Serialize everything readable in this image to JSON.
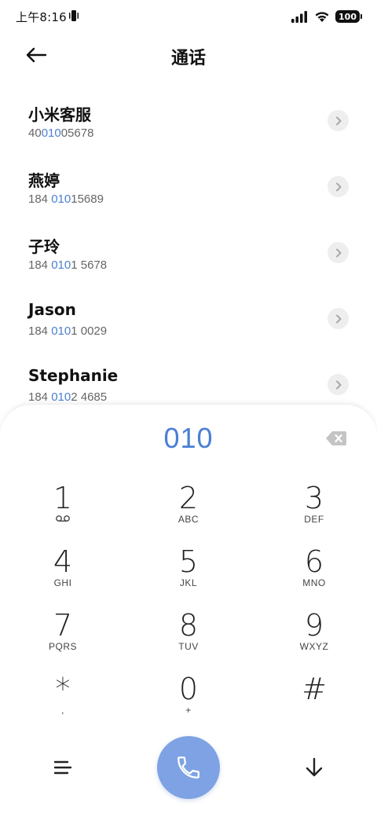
{
  "status_bar": {
    "time": "上午8:16",
    "battery": "100"
  },
  "header": {
    "title": "通话"
  },
  "contacts": [
    {
      "name": "小米客服",
      "number_pre": "40",
      "number_match": "010",
      "number_post": "05678"
    },
    {
      "name": "燕婷",
      "number_pre": "184 ",
      "number_match": "010",
      "number_post": "15689"
    },
    {
      "name": "子玲",
      "number_pre": "184 ",
      "number_match": "010",
      "number_post": "1 5678"
    },
    {
      "name": "Jason",
      "number_pre": "184 ",
      "number_match": "010",
      "number_post": "1 0029"
    },
    {
      "name": "Stephanie",
      "number_pre": "184 ",
      "number_match": "010",
      "number_post": "2 4685"
    }
  ],
  "dialpad": {
    "input": "010",
    "keys": [
      {
        "digit": "1",
        "sub": ""
      },
      {
        "digit": "2",
        "sub": "ABC"
      },
      {
        "digit": "3",
        "sub": "DEF"
      },
      {
        "digit": "4",
        "sub": "GHI"
      },
      {
        "digit": "5",
        "sub": "JKL"
      },
      {
        "digit": "6",
        "sub": "MNO"
      },
      {
        "digit": "7",
        "sub": "PQRS"
      },
      {
        "digit": "8",
        "sub": "TUV"
      },
      {
        "digit": "9",
        "sub": "WXYZ"
      },
      {
        "digit": "*",
        "sub": ","
      },
      {
        "digit": "0",
        "sub": "+"
      },
      {
        "digit": "#",
        "sub": ""
      }
    ]
  },
  "icons": {
    "back": "arrow-left-icon",
    "detail": "chevron-right-icon",
    "backspace": "backspace-icon",
    "voicemail": "voicemail-icon",
    "menu": "menu-icon",
    "call": "phone-icon",
    "hide": "arrow-down-icon"
  },
  "colors": {
    "accent": "#4a7fd4",
    "call_button": "#7ea2e4"
  }
}
